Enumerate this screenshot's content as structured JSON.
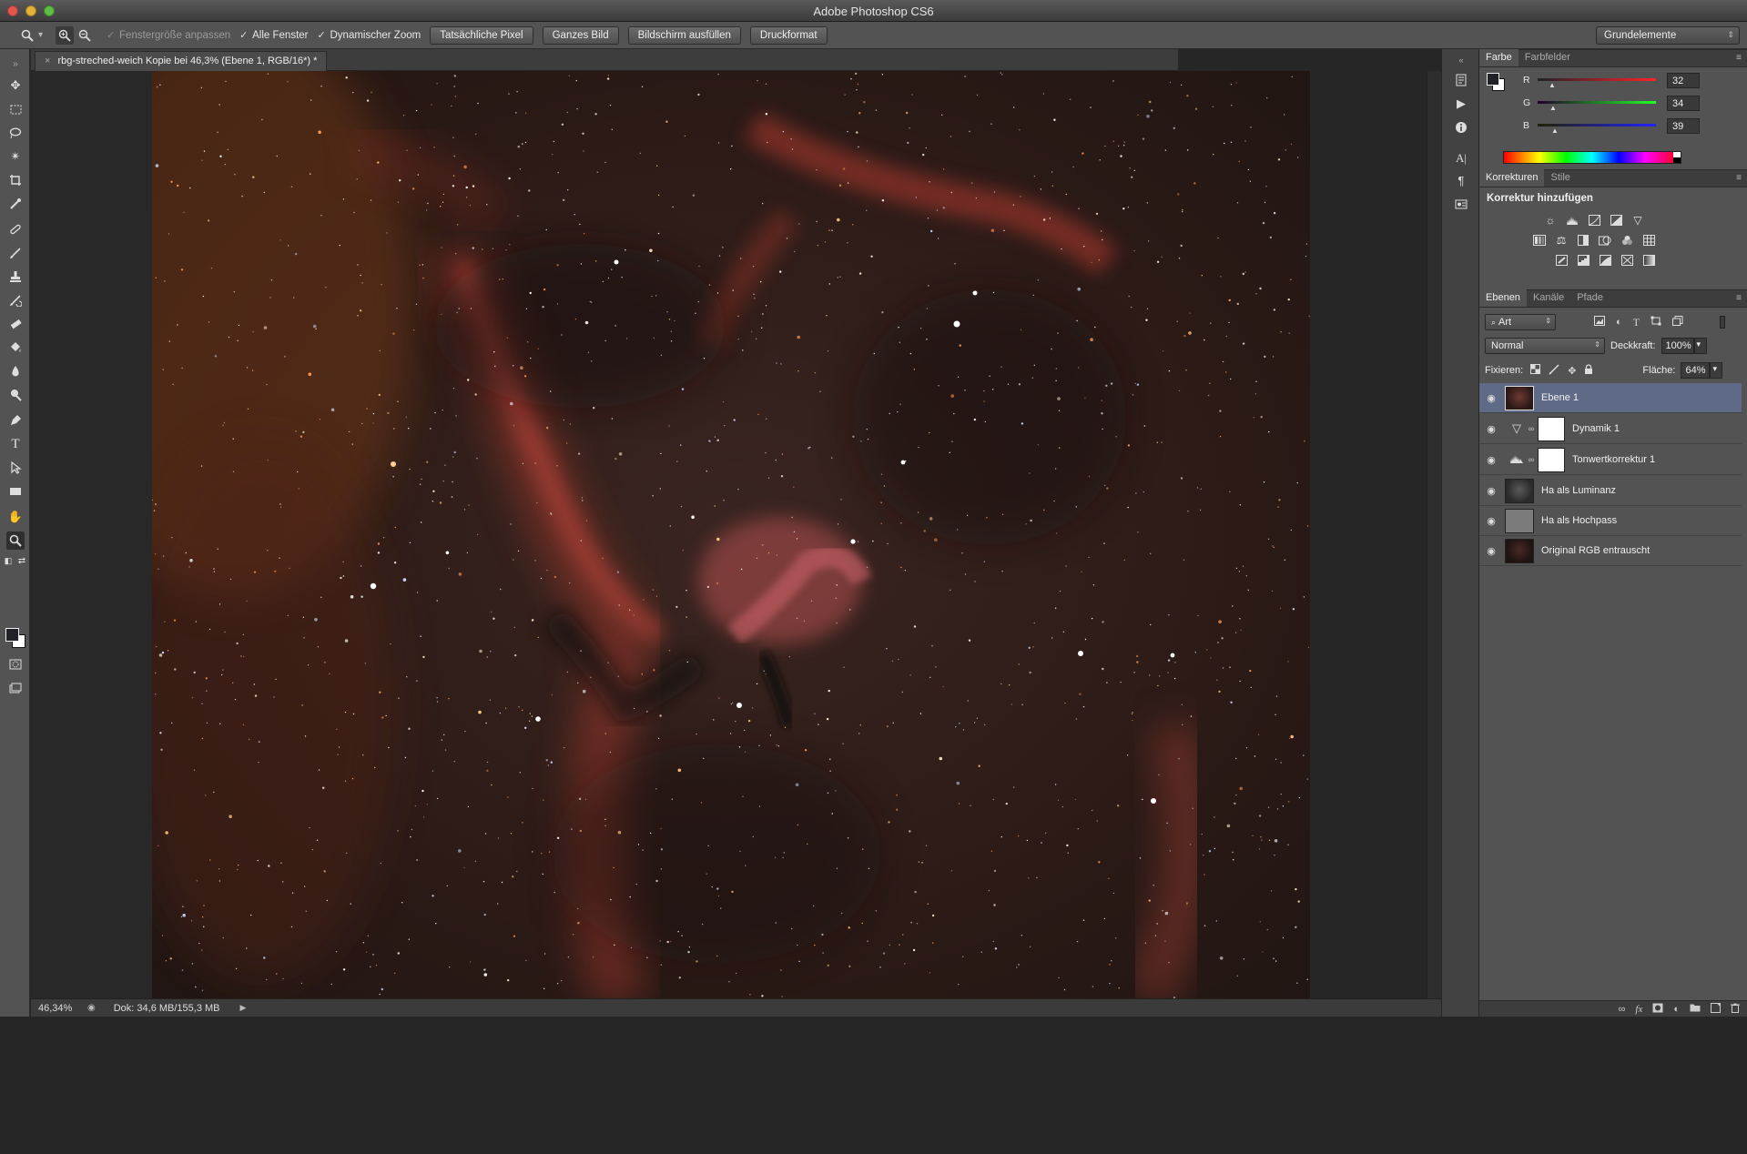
{
  "window": {
    "title": "Adobe Photoshop CS6"
  },
  "options_bar": {
    "zoom_menu_arrow": "▾",
    "checkbox_resize_windows": "Fenstergröße anpassen",
    "checkbox_all_windows": "Alle Fenster",
    "checkbox_scrubby_zoom": "Dynamischer Zoom",
    "btn_actual_pixels": "Tatsächliche Pixel",
    "btn_fit_screen": "Ganzes Bild",
    "btn_fill_screen": "Bildschirm ausfüllen",
    "btn_print_size": "Druckformat",
    "workspace": "Grundelemente"
  },
  "document": {
    "tab_title": "rbg-streched-weich Kopie bei 46,3% (Ebene 1, RGB/16*) *",
    "close_glyph": "×"
  },
  "status_bar": {
    "zoom": "46,34%",
    "doc_info": "Dok: 34,6 MB/155,3 MB",
    "arrow": "▶"
  },
  "color_panel": {
    "tabs": [
      "Farbe",
      "Farbfelder"
    ],
    "channels": [
      {
        "label": "R",
        "value": "32",
        "color": "#e0242a"
      },
      {
        "label": "G",
        "value": "34",
        "color": "#22c33b"
      },
      {
        "label": "B",
        "value": "39",
        "color": "#2b38e8"
      }
    ],
    "foreground": "#202227",
    "background": "#ffffff"
  },
  "adjustments_panel": {
    "tabs": [
      "Korrekturen",
      "Stile"
    ],
    "title": "Korrektur hinzufügen"
  },
  "layers_panel": {
    "tabs": [
      "Ebenen",
      "Kanäle",
      "Pfade"
    ],
    "filter_kind": "Art",
    "blend_mode": "Normal",
    "opacity_label": "Deckkraft:",
    "opacity_value": "100%",
    "lock_label": "Fixieren:",
    "fill_label": "Fläche:",
    "fill_value": "64%",
    "layers": [
      {
        "name": "Ebene 1",
        "selected": true
      },
      {
        "name": "Dynamik 1",
        "type": "vibrance"
      },
      {
        "name": "Tonwertkorrektur 1",
        "type": "levels"
      },
      {
        "name": "Ha als Luminanz"
      },
      {
        "name": "Ha als Hochpass"
      },
      {
        "name": "Original RGB entrauscht"
      }
    ]
  },
  "colors": {
    "accent_selected_layer": "#5f6b86",
    "ui_panel": "#535353",
    "ui_dark": "#3d3d3d"
  }
}
